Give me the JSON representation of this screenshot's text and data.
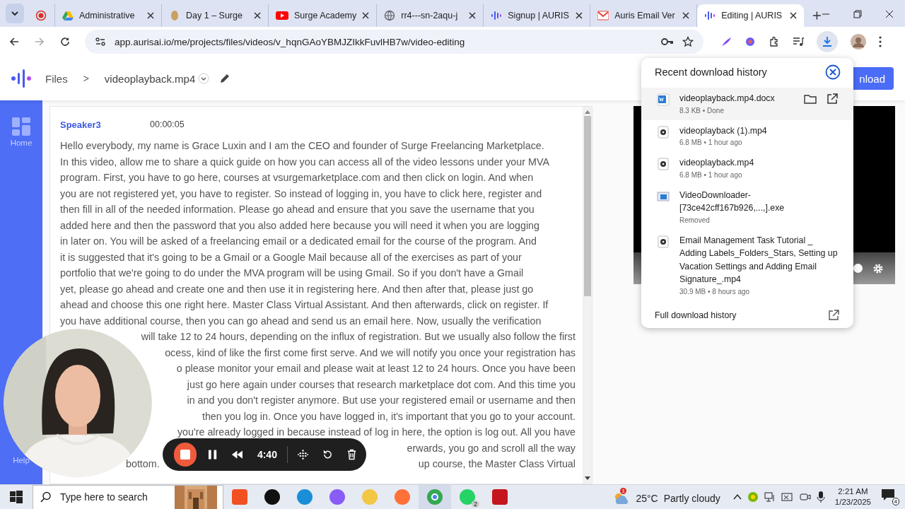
{
  "browser": {
    "tabs": [
      {
        "selected": false
      },
      {
        "title": "Administrative",
        "selected": false
      },
      {
        "title": "Day 1 – Surge",
        "selected": false
      },
      {
        "title": "Surge Academy",
        "selected": false
      },
      {
        "title": "rr4---sn-2aqu-j",
        "selected": false
      },
      {
        "title": "Signup | AURIS",
        "selected": false
      },
      {
        "title": "Auris Email Ver",
        "selected": false
      },
      {
        "title": "Editing | AURIS",
        "selected": true
      }
    ],
    "url": "app.aurisai.io/me/projects/files/videos/v_hqnGAoYBMJZIkkFuvlHB7w/video-editing"
  },
  "header": {
    "breadcrumb": "Files",
    "separator": ">",
    "file_name": "videoplayback.mp4",
    "download_button": "nload"
  },
  "sidebar": {
    "items": [
      "Home",
      "Help"
    ]
  },
  "transcript": {
    "speaker": "Speaker3",
    "timestamp": "00:00:05",
    "lines": [
      {
        "text": "Hello everybody, my name is Grace Luxin and I am the CEO and founder of Surge Freelancing Marketplace."
      },
      {
        "text": "In this video, allow me to share a quick guide on how you can access all of the video lessons under your MVA"
      },
      {
        "text": "program. First, you have to go here, courses at vsurgemarketplace.com and then click on login. And when"
      },
      {
        "text": "you are not registered yet, you have to register. So instead of logging in, you have to click here, register and"
      },
      {
        "text": "then fill in all of the needed information. Please go ahead and ensure that you save the username that you"
      },
      {
        "text": "added here and then the password that you also added here because you will need it when you are logging"
      },
      {
        "text": "in later on. You will be asked of a freelancing email or a dedicated email for the course of the program. And"
      },
      {
        "text": "it is suggested that it's going to be a Gmail or a Google Mail because all of the exercises as part of your"
      },
      {
        "text": "portfolio that we're going to do under the MVA program will be using Gmail. So if you don't have a Gmail"
      },
      {
        "text": "yet, please go ahead and create one and then use it in registering here. And then after that, please just go"
      },
      {
        "text": "ahead and choose this one right here. Master Class Virtual Assistant. And then afterwards, click on register. If"
      },
      {
        "text": "you have additional course, then you can go ahead and send us an email here. Now, usually the verification"
      },
      {
        "right": "will take 12 to 24 hours, depending on the influx of registration. But we usually also follow the first"
      },
      {
        "right": "ocess, kind of like the first come first serve. And we will notify you once your registration has"
      },
      {
        "right": "o please monitor your email and please wait at least 12 to 24 hours. Once you have been"
      },
      {
        "right": "just go here again under courses that research marketplace dot com. And this time you"
      },
      {
        "right": "in and you don't register anymore. But use your registered email or username and then"
      },
      {
        "right": "then you log in. Once you have logged in, it's important that you go to your account."
      },
      {
        "right": "you're already logged in because instead of log in here, the option is log out. All you have"
      },
      {
        "right": "erwards, you go and scroll all the way"
      },
      {
        "left": "bottom.",
        "right": "up course, the Master Class Virtual"
      }
    ]
  },
  "recorder": {
    "time": "4:40"
  },
  "downloads": {
    "title": "Recent download history",
    "items": [
      {
        "kind": "word",
        "name": "videoplayback.mp4.docx",
        "meta": "8.3 KB • Done",
        "highlighted": true
      },
      {
        "kind": "video",
        "name": "videoplayback (1).mp4",
        "meta": "6.8 MB • 1 hour ago",
        "highlighted": false
      },
      {
        "kind": "video",
        "name": "videoplayback.mp4",
        "meta": "6.8 MB • 1 hour ago",
        "highlighted": false
      },
      {
        "kind": "exe",
        "name": "VideoDownloader-[73ce42cff167b926,...,].exe",
        "meta": "Removed",
        "highlighted": false
      },
      {
        "kind": "video",
        "name": "Email Management Task Tutorial _ Adding Labels_Folders_Stars, Setting up Vacation Settings and Adding Email Signature_.mp4",
        "meta": "30.9 MB • 8 hours ago",
        "highlighted": false
      }
    ],
    "footer": "Full download history"
  },
  "taskbar": {
    "search_placeholder": "Type here to search",
    "app_badge": "2",
    "weather": {
      "badge": "1",
      "temperature": "25°C",
      "condition": "Partly cloudy"
    },
    "time": "2:21 AM",
    "date": "1/23/2025",
    "notifications": "4"
  }
}
